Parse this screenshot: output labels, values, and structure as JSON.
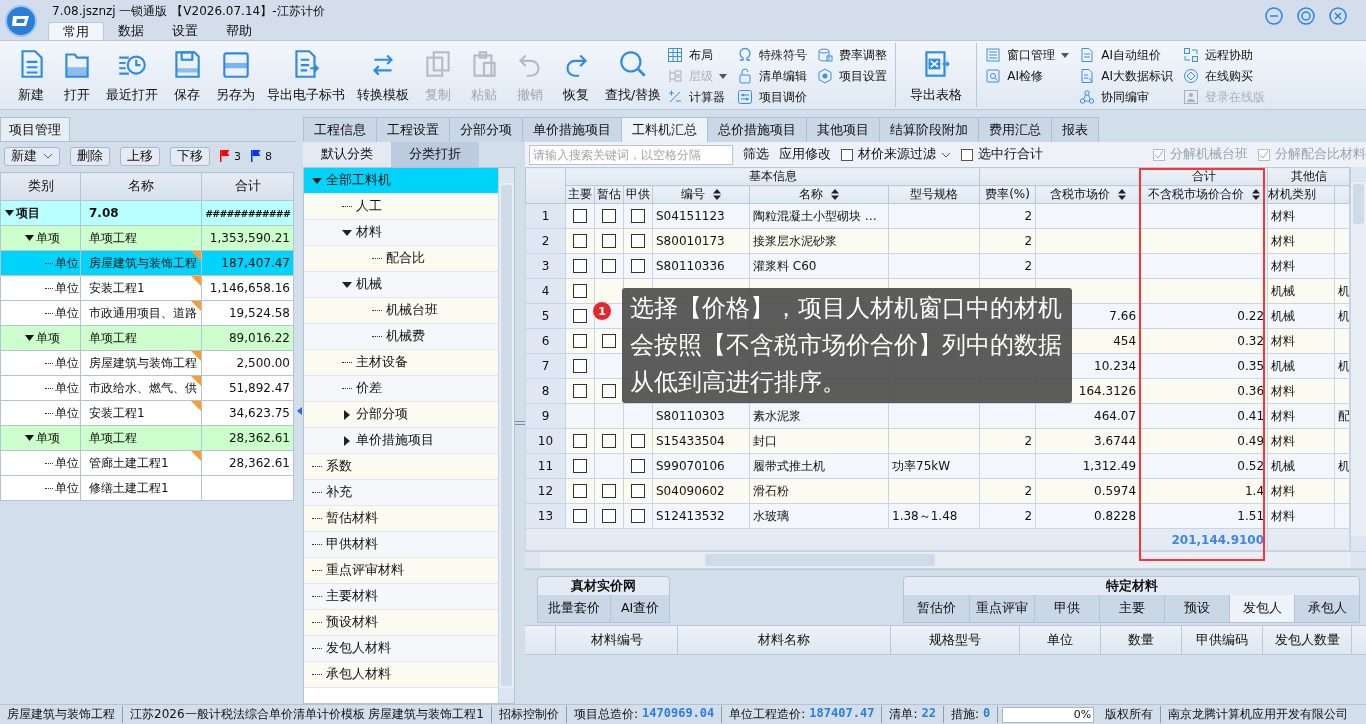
{
  "window": {
    "title": "7.08.jsznzj 一锁通版 【V2026.07.14】-江苏计价"
  },
  "menu_tabs": [
    {
      "label": "常用",
      "selected": true
    },
    {
      "label": "数据",
      "selected": false
    },
    {
      "label": "设置",
      "selected": false
    },
    {
      "label": "帮助",
      "selected": false
    }
  ],
  "ribbon": [
    {
      "kind": "large",
      "divider_before": false,
      "items": [
        {
          "label": "新建",
          "disabled": false
        },
        {
          "label": "打开",
          "disabled": false
        },
        {
          "label": "最近打开",
          "disabled": false
        },
        {
          "label": "保存",
          "disabled": false
        },
        {
          "label": "另存为",
          "disabled": false
        },
        {
          "label": "导出电子标书",
          "disabled": false
        },
        {
          "label": "转换模板",
          "disabled": false
        },
        {
          "label": "复制",
          "disabled": true
        },
        {
          "label": "粘贴",
          "disabled": true
        },
        {
          "label": "撤销",
          "disabled": true
        },
        {
          "label": "恢复",
          "disabled": false
        },
        {
          "label": "查找/替换",
          "disabled": false
        }
      ]
    },
    {
      "kind": "small",
      "divider_before": false,
      "columns": [
        [
          {
            "label": "布局",
            "disabled": false,
            "dropdown": false
          },
          {
            "label": "层级",
            "disabled": true,
            "dropdown": true
          },
          {
            "label": "计算器",
            "disabled": false,
            "dropdown": false
          }
        ],
        [
          {
            "label": "特殊符号",
            "disabled": false,
            "dropdown": false
          },
          {
            "label": "清单编辑",
            "disabled": false,
            "dropdown": false
          },
          {
            "label": "项目调价",
            "disabled": false,
            "dropdown": false
          }
        ],
        [
          {
            "label": "费率调整",
            "disabled": false,
            "dropdown": false
          },
          {
            "label": "项目设置",
            "disabled": false,
            "dropdown": false
          }
        ]
      ]
    },
    {
      "kind": "large",
      "divider_before": true,
      "items": [
        {
          "label": "导出表格",
          "disabled": false
        }
      ]
    },
    {
      "kind": "small",
      "divider_before": true,
      "columns": [
        [
          {
            "label": "窗口管理",
            "disabled": false,
            "dropdown": true
          },
          {
            "label": "AI检修",
            "disabled": false,
            "dropdown": false
          }
        ],
        [
          {
            "label": "AI自动组价",
            "disabled": false,
            "dropdown": false
          },
          {
            "label": "AI大数据标识",
            "disabled": false,
            "dropdown": false
          },
          {
            "label": "协同编审",
            "disabled": false,
            "dropdown": false
          }
        ],
        [
          {
            "label": "远程协助",
            "disabled": false,
            "dropdown": false
          },
          {
            "label": "在线购买",
            "disabled": false,
            "dropdown": false
          },
          {
            "label": "登录在线版",
            "disabled": true,
            "dropdown": false
          }
        ]
      ]
    }
  ],
  "project_panel": {
    "tab": "项目管理",
    "toolbar": [
      {
        "label": "新建",
        "dropdown": true
      },
      {
        "label": "删除",
        "dropdown": false
      },
      {
        "label": "上移",
        "dropdown": false
      },
      {
        "label": "下移",
        "dropdown": false
      }
    ],
    "flags": [
      {
        "color": "#ff0000",
        "count": "3"
      },
      {
        "color": "#0033ff",
        "count": "8"
      }
    ],
    "columns": [
      "类别",
      "名称",
      "合计"
    ],
    "rows": [
      {
        "kind": "project",
        "category": "项目",
        "name": "7.08",
        "total": "############",
        "selected": false,
        "marked": false,
        "expanded": true,
        "children": [
          {
            "kind": "item",
            "category": "单项",
            "name": "单项工程",
            "total": "1,353,590.21",
            "selected": false,
            "marked": false,
            "expanded": true,
            "children": [
              {
                "kind": "unit",
                "category": "单位",
                "name": "房屋建筑与装饰工程",
                "total": "187,407.47",
                "selected": true,
                "marked": true
              },
              {
                "kind": "unit",
                "category": "单位",
                "name": "安装工程1",
                "total": "1,146,658.16",
                "selected": false,
                "marked": true
              },
              {
                "kind": "unit",
                "category": "单位",
                "name": "市政通用项目、道路",
                "total": "19,524.58",
                "selected": false,
                "marked": true
              }
            ]
          },
          {
            "kind": "item",
            "category": "单项",
            "name": "单项工程",
            "total": "89,016.22",
            "selected": false,
            "marked": false,
            "expanded": true,
            "children": [
              {
                "kind": "unit",
                "category": "单位",
                "name": "房屋建筑与装饰工程",
                "total": "2,500.00",
                "selected": false,
                "marked": true
              },
              {
                "kind": "unit",
                "category": "单位",
                "name": "市政给水、燃气、供",
                "total": "51,892.47",
                "selected": false,
                "marked": true
              },
              {
                "kind": "unit",
                "category": "单位",
                "name": "安装工程1",
                "total": "34,623.75",
                "selected": false,
                "marked": true
              }
            ]
          },
          {
            "kind": "item",
            "category": "单项",
            "name": "单项工程",
            "total": "28,362.61",
            "selected": false,
            "marked": false,
            "expanded": true,
            "children": [
              {
                "kind": "unit",
                "category": "单位",
                "name": "管廊土建工程1",
                "total": "28,362.61",
                "selected": false,
                "marked": true
              },
              {
                "kind": "unit",
                "category": "单位",
                "name": "修缮土建工程1",
                "selected": false,
                "marked": false
              }
            ]
          }
        ]
      }
    ]
  },
  "main_tabs": [
    {
      "label": "工程信息",
      "selected": false
    },
    {
      "label": "工程设置",
      "selected": false
    },
    {
      "label": "分部分项",
      "selected": false
    },
    {
      "label": "单价措施项目",
      "selected": false
    },
    {
      "label": "工料机汇总",
      "selected": true
    },
    {
      "label": "总价措施项目",
      "selected": false
    },
    {
      "label": "其他项目",
      "selected": false
    },
    {
      "label": "结算阶段附加",
      "selected": false
    },
    {
      "label": "费用汇总",
      "selected": false
    },
    {
      "label": "报表",
      "selected": false
    }
  ],
  "category_panel": {
    "tabs": [
      {
        "label": "默认分类",
        "selected": true
      },
      {
        "label": "分类打折",
        "selected": false
      }
    ],
    "tree": [
      {
        "label": "全部工料机",
        "selected": true,
        "expanded": true,
        "children": [
          {
            "label": "人工",
            "selected": false
          },
          {
            "label": "材料",
            "selected": false,
            "expanded": true,
            "children": [
              {
                "label": "配合比",
                "selected": false
              }
            ]
          },
          {
            "label": "机械",
            "selected": false,
            "expanded": true,
            "children": [
              {
                "label": "机械台班",
                "selected": false
              },
              {
                "label": "机械费",
                "selected": false
              }
            ]
          },
          {
            "label": "主材设备",
            "selected": false
          },
          {
            "label": "价差",
            "selected": false
          },
          {
            "label": "分部分项",
            "selected": false,
            "expanded": false
          },
          {
            "label": "单价措施项目",
            "selected": false,
            "expanded": false
          }
        ]
      },
      {
        "label": "系数",
        "selected": false
      },
      {
        "label": "补充",
        "selected": false
      },
      {
        "label": "暂估材料",
        "selected": false
      },
      {
        "label": "甲供材料",
        "selected": false
      },
      {
        "label": "重点评审材料",
        "selected": false
      },
      {
        "label": "主要材料",
        "selected": false
      },
      {
        "label": "预设材料",
        "selected": false
      },
      {
        "label": "发包人材料",
        "selected": false
      },
      {
        "label": "承包人材料",
        "selected": false
      }
    ]
  },
  "toolbar": {
    "search": {
      "placeholder": "请输入搜索关键词，以空格分隔"
    },
    "buttons": [
      "筛选",
      "应用修改"
    ],
    "options": [
      {
        "label": "材价来源过滤",
        "checked": false,
        "disabled": false,
        "dropdown": true
      },
      {
        "label": "选中行合计",
        "checked": false,
        "disabled": false,
        "dropdown": false
      }
    ],
    "right_options": [
      {
        "label": "分解机械台班",
        "checked": true,
        "disabled": true
      },
      {
        "label": "分解配合比材料",
        "checked": true,
        "disabled": true
      }
    ]
  },
  "table": {
    "groups": [
      {
        "label": "基本信息",
        "columns": [
          {
            "label": "主要",
            "sortable": false
          },
          {
            "label": "暂估",
            "sortable": false
          },
          {
            "label": "甲供",
            "sortable": false
          },
          {
            "label": "编号",
            "sortable": true
          },
          {
            "label": "名称",
            "sortable": true
          },
          {
            "label": "型号规格",
            "sortable": false
          }
        ]
      },
      {
        "columns": [
          {
            "label": "费率(%)",
            "sortable": false
          },
          {
            "label": "含税市场价",
            "sortable": true
          }
        ]
      },
      {
        "label": "合计",
        "columns": [
          {
            "label": "不含税市场价合价",
            "sortable": true
          }
        ]
      },
      {
        "label": "其他信",
        "columns": [
          {
            "label": "材机类别",
            "sortable": false
          },
          {
            "sortable": false
          }
        ]
      }
    ],
    "rows": [
      {
        "index": "1",
        "checks": {
          "main": {
            "checked": false
          },
          "provisional": {
            "checked": false
          },
          "supplied": {
            "checked": false
          }
        },
        "code": "S04151123",
        "name": "陶粒混凝土小型砌块 …",
        "rate": "2",
        "type": "材料"
      },
      {
        "index": "2",
        "checks": {
          "main": {
            "checked": false
          },
          "provisional": {
            "checked": false
          },
          "supplied": {
            "checked": false
          }
        },
        "code": "S80010173",
        "name": "接浆层水泥砂浆",
        "rate": "2",
        "type": "材料"
      },
      {
        "index": "3",
        "checks": {
          "main": {
            "checked": false
          },
          "provisional": {
            "checked": false
          },
          "supplied": {
            "checked": false
          }
        },
        "code": "S80110336",
        "name": "灌浆料 C60",
        "rate": "2",
        "type": "材料"
      },
      {
        "index": "4",
        "checks": {
          "main": {
            "checked": false
          }
        },
        "type": "机械",
        "other": "机"
      },
      {
        "index": "5",
        "checks": {
          "main": {
            "checked": false
          }
        },
        "price": "7.66",
        "total": "0.22",
        "type": "机械",
        "other": "机"
      },
      {
        "index": "6",
        "checks": {
          "main": {
            "checked": false
          },
          "provisional": {
            "checked": false
          }
        },
        "price": "454",
        "total": "0.32",
        "type": "材料"
      },
      {
        "index": "7",
        "checks": {
          "main": {
            "checked": false
          }
        },
        "price": "10.234",
        "total": "0.35",
        "type": "机械",
        "other": "机"
      },
      {
        "index": "8",
        "checks": {
          "main": {
            "checked": false
          },
          "provisional": {
            "checked": false
          }
        },
        "price": "164.3126",
        "total": "0.36",
        "type": "材料"
      },
      {
        "index": "9",
        "code": "S80110303",
        "name": "素水泥浆",
        "price": "464.07",
        "total": "0.41",
        "type": "材料",
        "other": "配"
      },
      {
        "index": "10",
        "checks": {
          "main": {
            "checked": false
          },
          "provisional": {
            "checked": false
          },
          "supplied": {
            "checked": false
          }
        },
        "code": "S15433504",
        "name": "封口",
        "rate": "2",
        "price": "3.6744",
        "total": "0.49",
        "type": "材料"
      },
      {
        "index": "11",
        "checks": {
          "main": {
            "checked": false
          },
          "supplied": {
            "checked": false
          }
        },
        "code": "S99070106",
        "name": "履带式推土机",
        "spec": "功率75kW",
        "price": "1,312.49",
        "total": "0.52",
        "type": "机械",
        "other": "机"
      },
      {
        "index": "12",
        "checks": {
          "main": {
            "checked": false
          },
          "provisional": {
            "checked": false
          },
          "supplied": {
            "checked": false
          }
        },
        "code": "S04090602",
        "name": "滑石粉",
        "rate": "2",
        "price": "0.5974",
        "total": "1.4",
        "type": "材料"
      },
      {
        "index": "13",
        "checks": {
          "main": {
            "checked": false
          },
          "provisional": {
            "checked": false
          },
          "supplied": {
            "checked": false
          }
        },
        "code": "S12413532",
        "name": "水玻璃",
        "spec": "1.38～1.48",
        "rate": "2",
        "price": "0.8228",
        "total": "1.51",
        "type": "材料"
      }
    ],
    "footer_total": "201,144.9100"
  },
  "callout": {
    "badge": "1",
    "text": "选择【价格】，项目人材机窗口中的材机会按照【不含税市场价合价】列中的数据从低到高进行排序。"
  },
  "price_net": {
    "title": "真材实价网",
    "buttons": [
      "批量套价",
      "AI查价"
    ]
  },
  "special_materials": {
    "title": "特定材料",
    "tabs": [
      {
        "label": "暂估价",
        "selected": false
      },
      {
        "label": "重点评审",
        "selected": false
      },
      {
        "label": "甲供",
        "selected": false
      },
      {
        "label": "主要",
        "selected": false
      },
      {
        "label": "预设",
        "selected": false
      },
      {
        "label": "发包人",
        "selected": true
      },
      {
        "label": "承包人",
        "selected": false
      }
    ]
  },
  "lower_table": {
    "columns": [
      "材料编号",
      "材料名称",
      "规格型号",
      "单位",
      "数量",
      "甲供编码",
      "发包人数量"
    ]
  },
  "status_bar": {
    "items": [
      {
        "label": "房屋建筑与装饰工程"
      },
      {
        "label": "江苏2026一般计税法综合单价清单计价模板 房屋建筑与装饰工程1"
      },
      {
        "label": "招标控制价"
      },
      {
        "label": "项目总造价:",
        "value": "1470969.04"
      },
      {
        "label": "单位工程造价:",
        "value": "187407.47"
      },
      {
        "label": "清单:",
        "value": "22"
      },
      {
        "label": "措施:",
        "value": "0"
      }
    ],
    "progress": {
      "level": 0,
      "text": "0%"
    },
    "copyright": "版权所有",
    "company": "南京龙腾计算机应用开发有限公司"
  }
}
